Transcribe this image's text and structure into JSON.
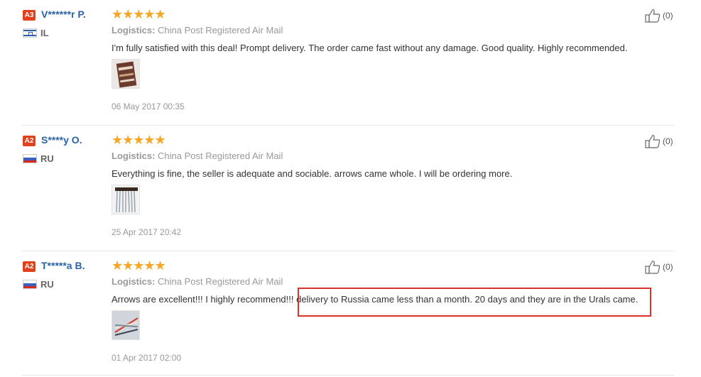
{
  "reviews": [
    {
      "level": "A3",
      "name": "V******r P.",
      "country": "IL",
      "stars": "★★★★★",
      "logistics_label": "Logistics:",
      "logistics_value": "China Post Registered Air Mail",
      "text": "I'm fully satisfied with this deal! Prompt delivery. The order came fast without any damage. Good quality. Highly recommended.",
      "date": "06 May 2017 00:35",
      "likes": "(0)"
    },
    {
      "level": "A2",
      "name": "S****y O.",
      "country": "RU",
      "stars": "★★★★★",
      "logistics_label": "Logistics:",
      "logistics_value": "China Post Registered Air Mail",
      "text": "Everything is fine, the seller is adequate and sociable. arrows came whole. I will be ordering more.",
      "date": "25 Apr 2017 20:42",
      "likes": "(0)"
    },
    {
      "level": "A2",
      "name": "T*****a B.",
      "country": "RU",
      "stars": "★★★★★",
      "logistics_label": "Logistics:",
      "logistics_value": "China Post Registered Air Mail",
      "text": "Arrows are excellent!!! I highly recommend!!! delivery to Russia came less than a month. 20 days and they are in the Urals came.",
      "date": "01 Apr 2017 02:00",
      "likes": "(0)"
    }
  ],
  "colors": {
    "level_badge": "#e0401c",
    "username": "#2962a8",
    "stars": "#f5a623",
    "highlight_box": "#d9342b"
  }
}
